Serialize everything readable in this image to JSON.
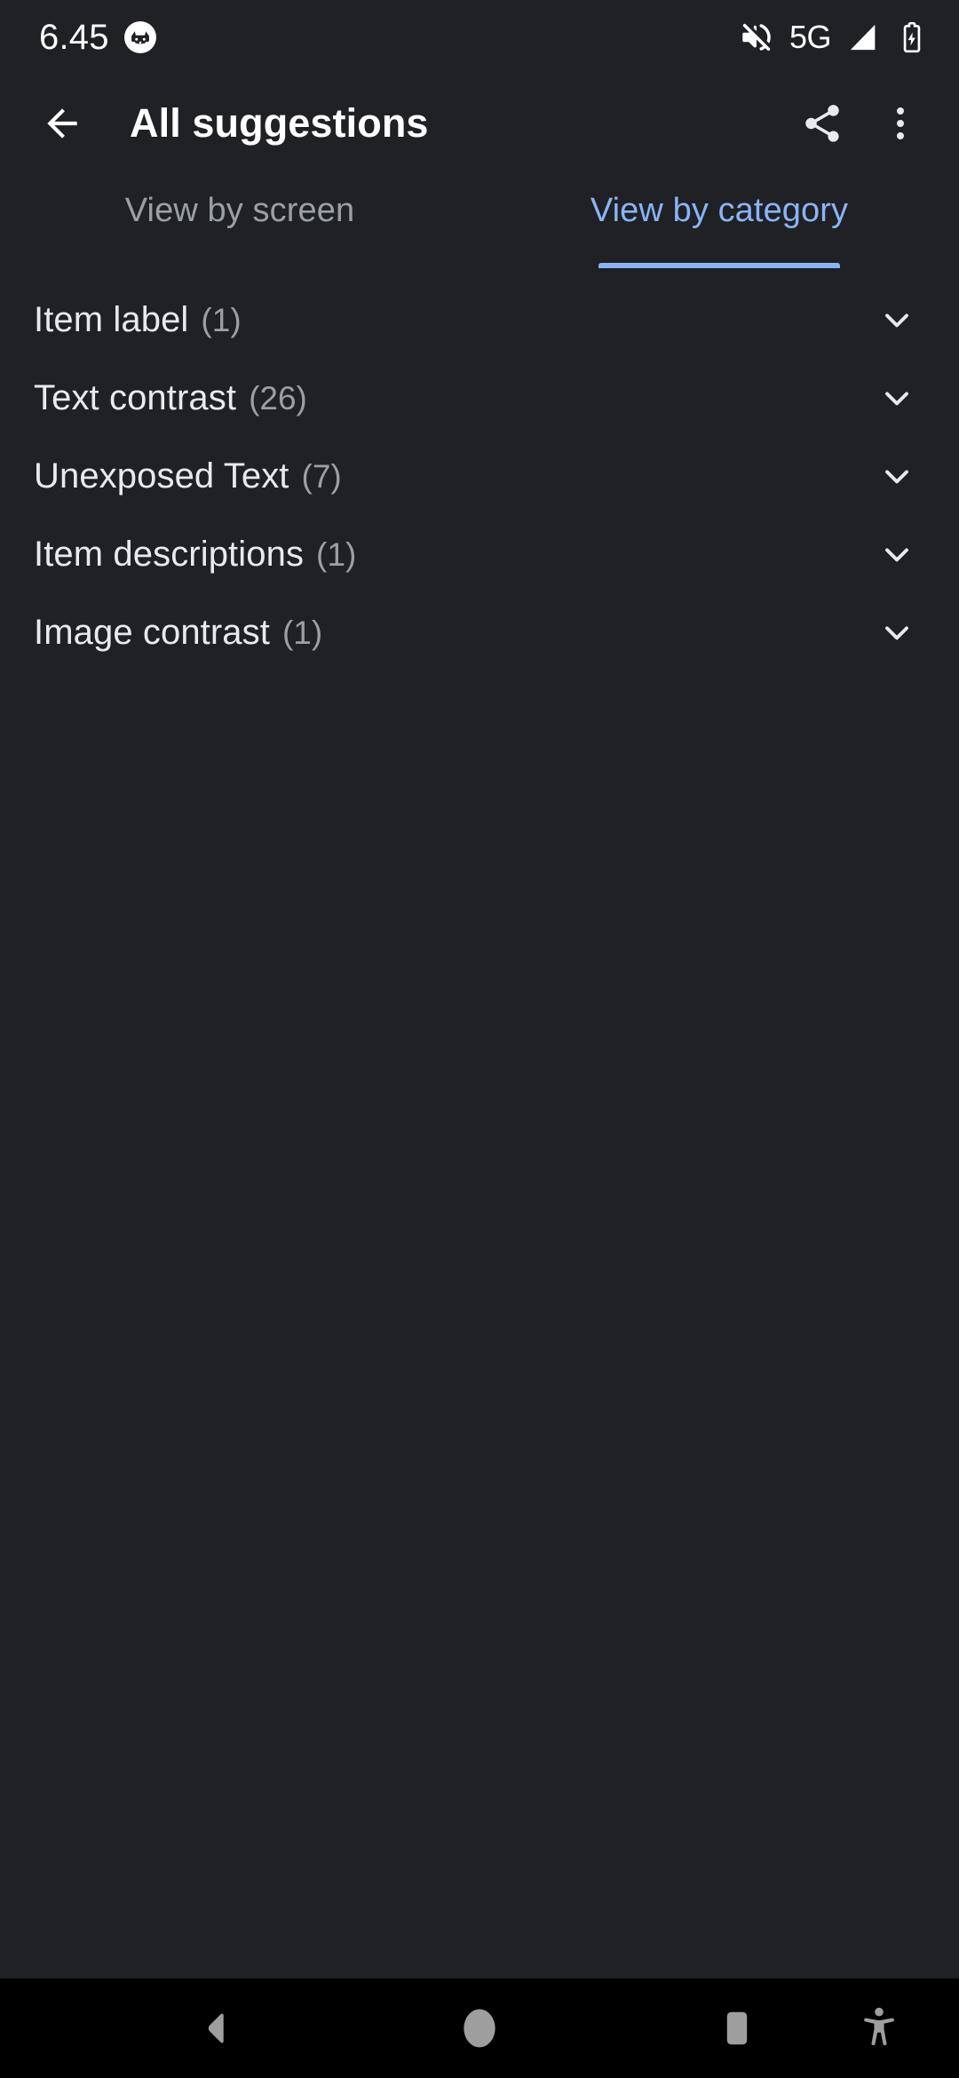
{
  "status_bar": {
    "time": "6.45",
    "notification_icon": "app-notification-icon",
    "icons": [
      {
        "name": "volume-off-icon"
      },
      {
        "name": "signal-icon"
      },
      {
        "name": "battery-charging-icon"
      }
    ],
    "network_label": "5G"
  },
  "app_bar": {
    "back_icon": "back-arrow-icon",
    "title": "All suggestions",
    "share_icon": "share-icon",
    "overflow_icon": "more-vert-icon"
  },
  "tabs": [
    {
      "label": "View by screen",
      "active": false
    },
    {
      "label": "View by category",
      "active": true
    }
  ],
  "categories": [
    {
      "label": "Item label",
      "count": "(1)",
      "chevron": "chevron-down-icon"
    },
    {
      "label": "Text contrast",
      "count": "(26)",
      "chevron": "chevron-down-icon"
    },
    {
      "label": "Unexposed Text",
      "count": "(7)",
      "chevron": "chevron-down-icon"
    },
    {
      "label": "Item descriptions",
      "count": "(1)",
      "chevron": "chevron-down-icon"
    },
    {
      "label": "Image contrast",
      "count": "(1)",
      "chevron": "chevron-down-icon"
    }
  ],
  "nav_bar": {
    "back": "nav-back-icon",
    "home": "nav-home-icon",
    "recents": "nav-recents-icon",
    "accessibility": "nav-accessibility-icon"
  },
  "colors": {
    "background": "#202124",
    "accent": "#8ab4f8",
    "primary_text": "#e8eaed",
    "secondary_text": "#9aa0a6",
    "nav_background": "#000000",
    "nav_icon": "#9e9e9e"
  }
}
